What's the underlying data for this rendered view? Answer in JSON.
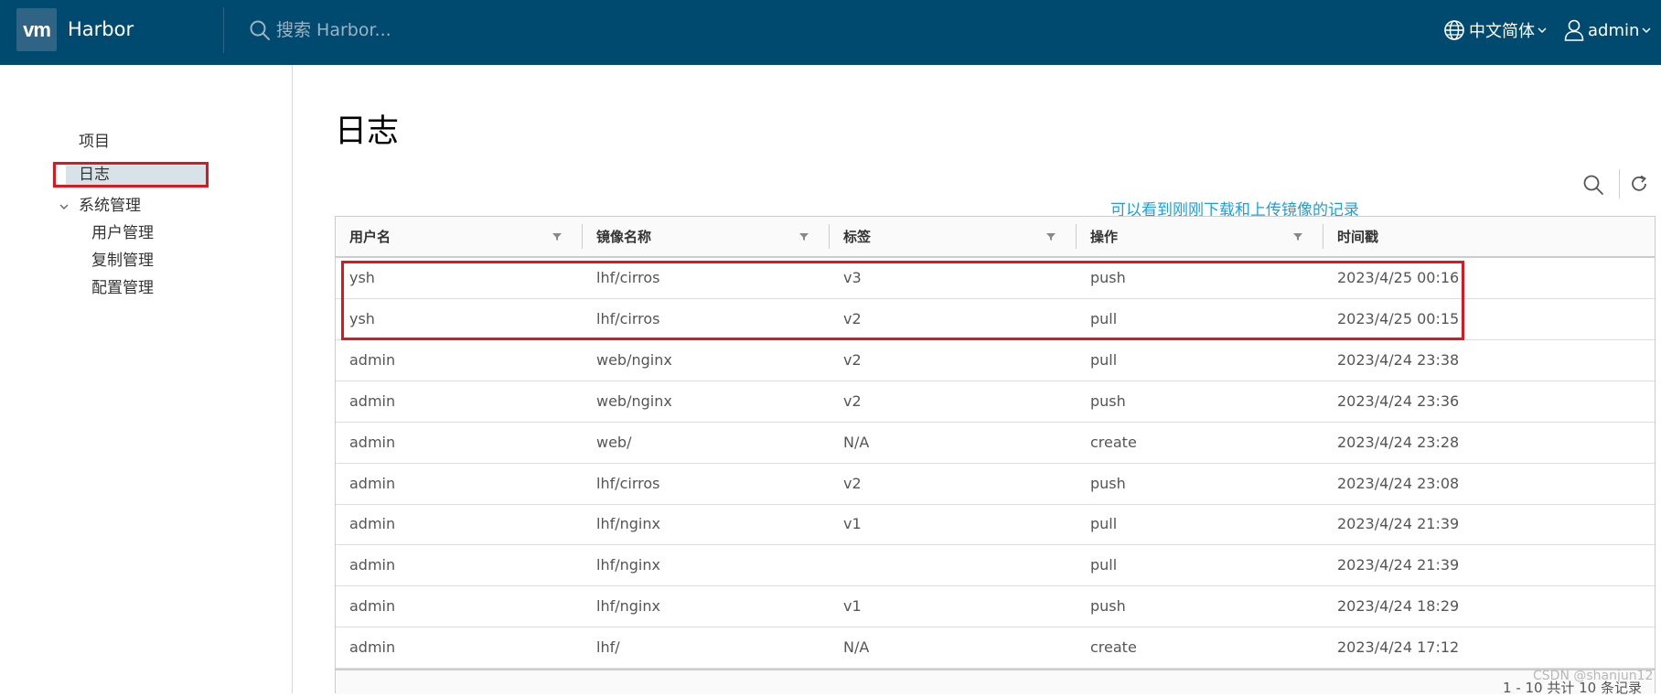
{
  "header": {
    "logo_text": "vm",
    "app_title": "Harbor",
    "search_placeholder": "搜索 Harbor...",
    "language": "中文简体",
    "user": "admin",
    "bg_color": "#004a70"
  },
  "sidebar": {
    "items": [
      {
        "label": "项目"
      },
      {
        "label": "日志",
        "active": true
      },
      {
        "label": "系统管理",
        "expanded": true
      }
    ],
    "sub_items": [
      {
        "label": "用户管理"
      },
      {
        "label": "复制管理"
      },
      {
        "label": "配置管理"
      }
    ]
  },
  "main": {
    "title": "日志",
    "annotation": "可以看到刚刚下载和上传镜像的记录",
    "columns": [
      "用户名",
      "镜像名称",
      "标签",
      "操作",
      "时间戳"
    ],
    "rows": [
      [
        "ysh",
        "lhf/cirros",
        "v3",
        "push",
        "2023/4/25 00:16"
      ],
      [
        "ysh",
        "lhf/cirros",
        "v2",
        "pull",
        "2023/4/25 00:15"
      ],
      [
        "admin",
        "web/nginx",
        "v2",
        "pull",
        "2023/4/24 23:38"
      ],
      [
        "admin",
        "web/nginx",
        "v2",
        "push",
        "2023/4/24 23:36"
      ],
      [
        "admin",
        "web/",
        "N/A",
        "create",
        "2023/4/24 23:28"
      ],
      [
        "admin",
        "lhf/cirros",
        "v2",
        "push",
        "2023/4/24 23:08"
      ],
      [
        "admin",
        "lhf/nginx",
        "v1",
        "pull",
        "2023/4/24 21:39"
      ],
      [
        "admin",
        "lhf/nginx",
        "",
        "pull",
        "2023/4/24 21:39"
      ],
      [
        "admin",
        "lhf/nginx",
        "v1",
        "push",
        "2023/4/24 18:29"
      ],
      [
        "admin",
        "lhf/",
        "N/A",
        "create",
        "2023/4/24 17:12"
      ]
    ],
    "footer": "1 - 10 共计 10 条记录"
  },
  "watermark": "CSDN @shanjun12",
  "colors": {
    "accent": "#004a70",
    "highlight": "#e0161e",
    "annotation": "#1e9ee0",
    "active_nav": "#d8e3e9"
  }
}
